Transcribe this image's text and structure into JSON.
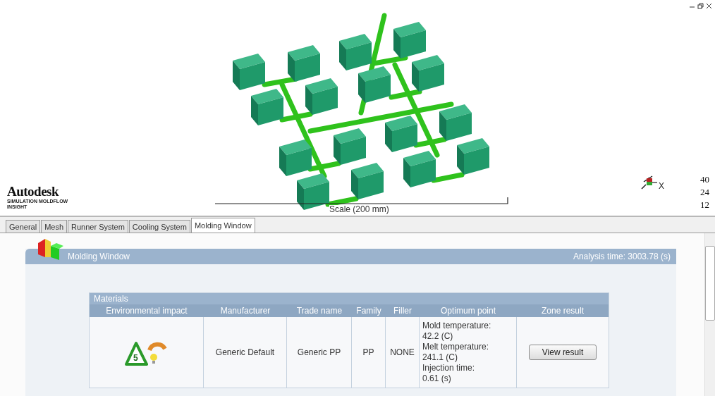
{
  "viewport": {
    "logo": {
      "name": "Autodesk",
      "tagline": "SIMULATION MOLDFLOW INSIGHT"
    },
    "scale_label": "Scale (200 mm)",
    "axis_label": "X",
    "ruler": [
      "40",
      "24",
      "12"
    ]
  },
  "tabs": [
    {
      "label": "General",
      "selected": false
    },
    {
      "label": "Mesh",
      "selected": false
    },
    {
      "label": "Runner System",
      "selected": false
    },
    {
      "label": "Cooling System",
      "selected": false
    },
    {
      "label": "Molding Window",
      "selected": true
    }
  ],
  "panel": {
    "title": "Molding Window",
    "analysis_time": "Analysis time: 3003.78 (s)",
    "materials": {
      "title": "Materials",
      "columns": [
        "Environmental impact",
        "Manufacturer",
        "Trade name",
        "Family",
        "Filler",
        "Optimum point",
        "Zone result"
      ],
      "rows": [
        {
          "recycle_code": "5",
          "manufacturer": "Generic Default",
          "trade_name": "Generic PP",
          "family": "PP",
          "filler": "NONE",
          "optimum": [
            "Mold temperature:",
            "42.2 (C)",
            "Melt temperature:",
            "241.1 (C)",
            "Injection time:",
            "0.61 (s)"
          ],
          "button": "View result"
        }
      ]
    }
  }
}
